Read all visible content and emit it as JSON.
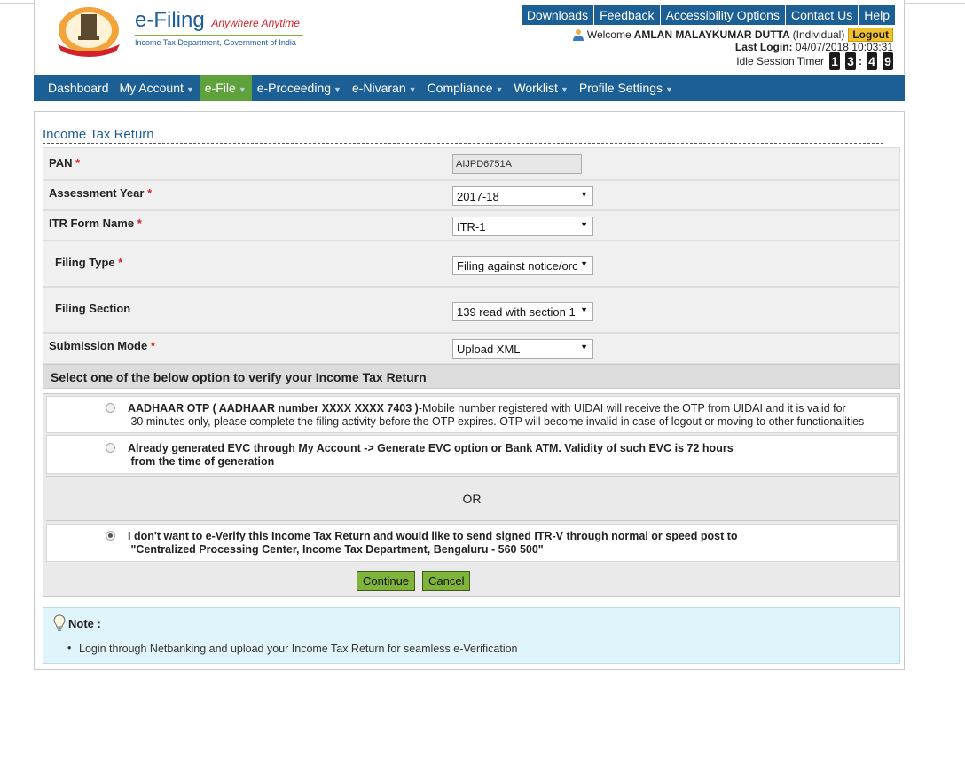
{
  "header": {
    "brand_name": "e-Filing",
    "brand_tagline": "Anywhere Anytime",
    "brand_subtitle": "Income Tax Department, Government of India",
    "top_links": [
      "Downloads",
      "Feedback",
      "Accessibility Options",
      "Contact Us",
      "Help"
    ],
    "welcome_prefix": "Welcome",
    "user_name": "AMLAN MALAYKUMAR DUTTA",
    "user_type": "(Individual)",
    "logout_label": "Logout",
    "last_login_label": "Last Login:",
    "last_login_value": "04/07/2018 10:03:31",
    "idle_label": "Idle Session Timer",
    "idle_digits": [
      "1",
      "3",
      "4",
      "9"
    ]
  },
  "nav": {
    "items": [
      {
        "label": "Dashboard"
      },
      {
        "label": "My Account"
      },
      {
        "label": "e-File"
      },
      {
        "label": "e-Proceeding"
      },
      {
        "label": "e-Nivaran"
      },
      {
        "label": "Compliance"
      },
      {
        "label": "Worklist"
      },
      {
        "label": "Profile Settings"
      }
    ]
  },
  "form": {
    "title": "Income Tax Return",
    "pan_label": "PAN",
    "pan_value": "AIJPD6751A",
    "ay_label": "Assessment Year",
    "ay_value": "2017-18",
    "itr_label": "ITR Form Name",
    "itr_value": "ITR-1",
    "filing_type_label": "Filing Type",
    "filing_type_value": "Filing against notice/orc",
    "filing_section_label": "Filing Section",
    "filing_section_value": "139 read with section 1",
    "submission_label": "Submission Mode",
    "submission_value": "Upload XML",
    "required_mark": "*"
  },
  "verify": {
    "heading": "Select one of the below option to verify your Income Tax Return",
    "aadhaar_bold": "AADHAAR OTP ( AADHAAR number XXXX XXXX 7403 )",
    "aadhaar_rest": "-Mobile number registered with UIDAI will receive the OTP from UIDAI and it is valid for",
    "aadhaar_line2": "30 minutes only, please complete the filing activity before the OTP expires. OTP will become invalid in case of logout or moving to other functionalities",
    "evc_line1": "Already generated EVC through My Account -> Generate EVC option or Bank ATM. Validity of such EVC is 72 hours",
    "evc_line2": "from the time of generation",
    "or_label": "OR",
    "itrv_line1": "I don't want to e-Verify this Income Tax Return and would like to send signed ITR-V through normal or speed post to",
    "itrv_line2": "\"Centralized Processing Center, Income Tax Department, Bengaluru - 560 500\""
  },
  "buttons": {
    "continue_label": "Continue",
    "cancel_label": "Cancel"
  },
  "note": {
    "title": "Note :",
    "item": "Login through Netbanking and upload your Income Tax Return for seamless e-Verification"
  }
}
